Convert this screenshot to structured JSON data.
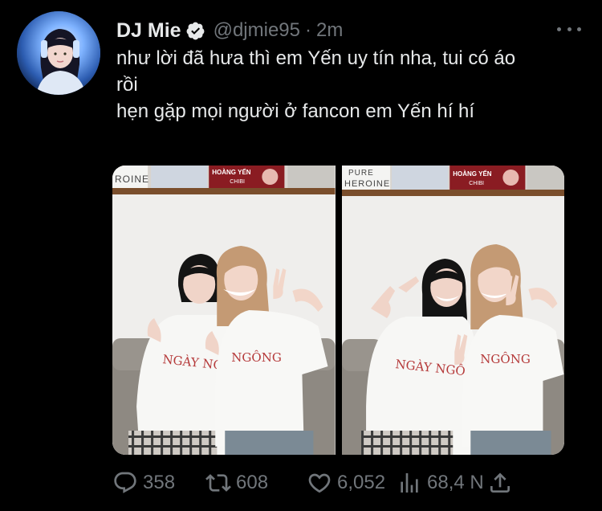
{
  "author": {
    "display_name": "DJ Mie",
    "handle": "@djmie95",
    "separator": "·",
    "time": "2m",
    "verified": true,
    "avatar_icon": "user-avatar"
  },
  "tweet": {
    "lines": [
      "như lời đã hưa thì em Yến uy tín nha, tui có áo",
      "rồi",
      "hẹn gặp mọi người ở fancon em Yến hí hí"
    ]
  },
  "media": {
    "photos": [
      {
        "poster_left_text": "ROINE",
        "poster_mid_line1": "HOÀNG YẾN",
        "poster_mid_line2": "CHIBI",
        "shirt_left_text": "NGÀY NGÔNG",
        "shirt_right_text": "NGÔNG"
      },
      {
        "poster_left_line1": "PURE",
        "poster_left_line2": "HEROINE",
        "poster_mid_line1": "HOÀNG YẾN",
        "poster_mid_line2": "CHIBI",
        "shirt_left_text": "NGÀY NGÔNG",
        "shirt_right_text": "NGÔNG"
      }
    ]
  },
  "actions": {
    "reply_count": "358",
    "retweet_count": "608",
    "like_count": "6,052",
    "views_count": "68,4 N",
    "icons": [
      "reply-icon",
      "retweet-icon",
      "like-icon",
      "views-icon",
      "share-icon"
    ]
  },
  "colors": {
    "background": "#000000",
    "text_primary": "#e7e9ea",
    "text_secondary": "#71767b"
  }
}
